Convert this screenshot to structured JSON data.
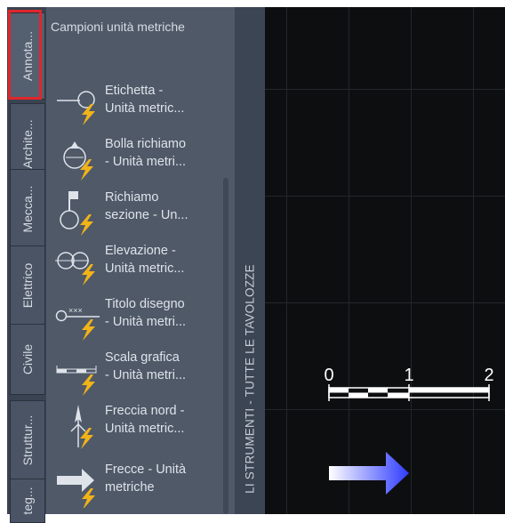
{
  "tabs": [
    {
      "label": "Annota..."
    },
    {
      "label": "Archite..."
    },
    {
      "label": "Mecca..."
    },
    {
      "label": "Elettrico"
    },
    {
      "label": "Civile"
    },
    {
      "label": "Struttur..."
    },
    {
      "label": "teg..."
    }
  ],
  "palette": {
    "title": "Campioni unità metriche",
    "tools": [
      {
        "line1": "Etichetta -",
        "line2": "Unità metric...",
        "icon": "label-tag-icon"
      },
      {
        "line1": "Bolla richiamo",
        "line2": "- Unità metri...",
        "icon": "callout-bubble-icon"
      },
      {
        "line1": "Richiamo",
        "line2": "sezione - Un...",
        "icon": "section-callout-icon"
      },
      {
        "line1": "Elevazione -",
        "line2": "Unità metric...",
        "icon": "elevation-icon"
      },
      {
        "line1": "Titolo disegno",
        "line2": "- Unità metri...",
        "icon": "drawing-title-icon"
      },
      {
        "line1": "Scala grafica",
        "line2": "- Unità metri...",
        "icon": "graphic-scale-icon"
      },
      {
        "line1": "Freccia nord -",
        "line2": "Unità metric...",
        "icon": "north-arrow-icon"
      },
      {
        "line1": "Frecce - Unità",
        "line2": "metriche",
        "icon": "arrows-icon"
      }
    ]
  },
  "side_title": "LI STRUMENTI - TUTTE LE TAVOLOZZE",
  "canvas": {
    "scale_labels": [
      "0",
      "1",
      "2"
    ]
  },
  "colors": {
    "tab_strip": "#3a4351",
    "palette_bg": "#4f5968",
    "highlight": "#e0262b",
    "canvas_bg": "#0d0e10",
    "bolt": "#f2b318",
    "arrow_blue": "#2f3cff"
  }
}
